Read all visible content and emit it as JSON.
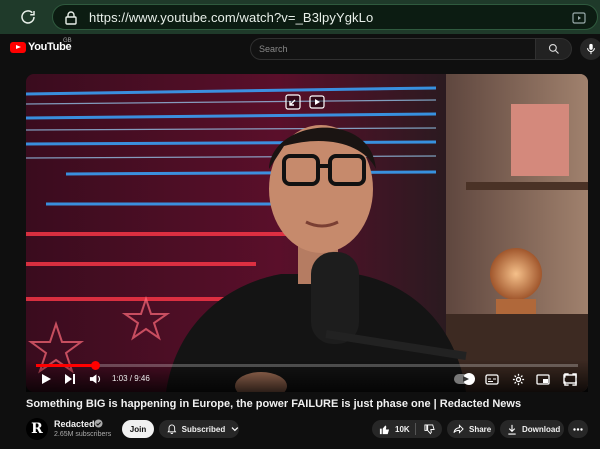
{
  "browser": {
    "url": "https://www.youtube.com/watch?v=_B3lpyYgkLo"
  },
  "header": {
    "logo_text": "YouTube",
    "region": "GB",
    "search_placeholder": "Search"
  },
  "player": {
    "time_display": "1:03 / 9:46",
    "progress_fraction": 0.108
  },
  "video": {
    "title": "Something BIG is happening in Europe, the power FAILURE is just phase one | Redacted News"
  },
  "channel": {
    "avatar_letter": "R",
    "name": "Redacted",
    "subscribers": "2.65M subscribers",
    "join_label": "Join",
    "subscribed_label": "Subscribed"
  },
  "actions": {
    "like_count": "10K",
    "share_label": "Share",
    "download_label": "Download"
  },
  "colors": {
    "accent": "#ff0000",
    "browser_frame": "#1f3a2a"
  }
}
